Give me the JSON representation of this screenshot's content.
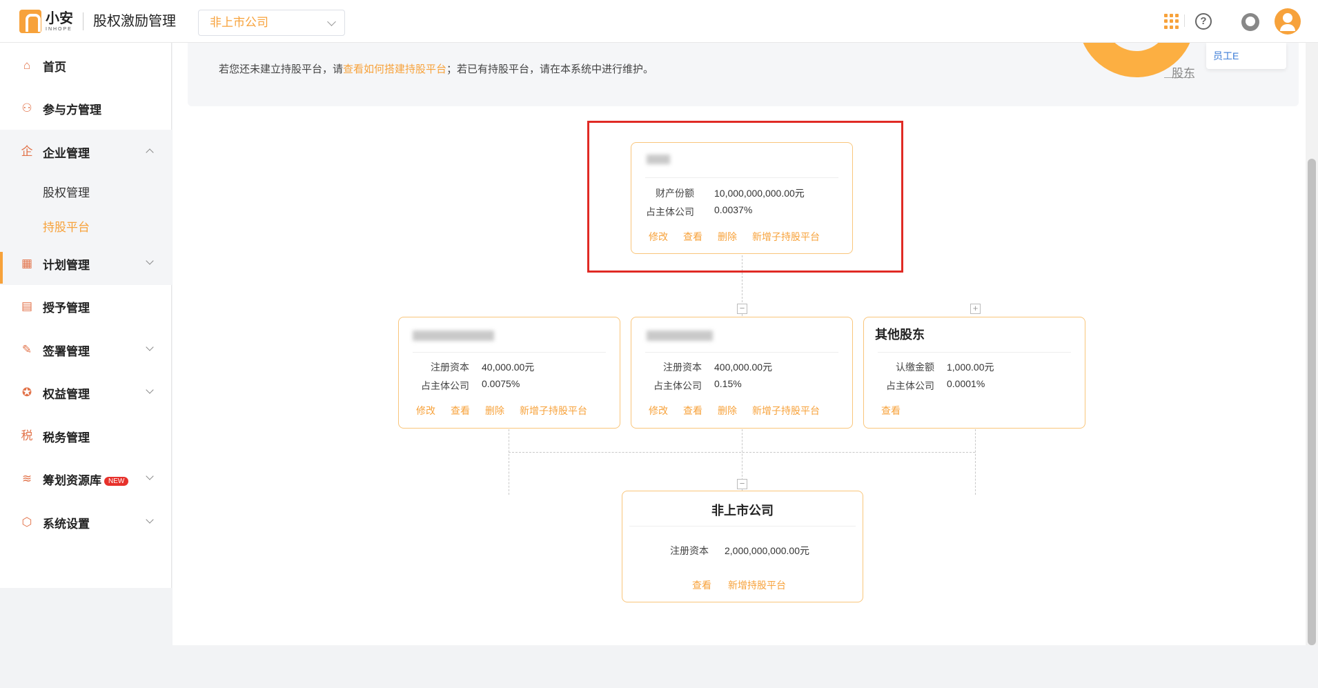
{
  "header": {
    "logo_cn": "小安",
    "logo_en": "INHOPE",
    "system_title": "股权激励管理",
    "company_select": "非上市公司"
  },
  "sidebar": {
    "items": [
      {
        "label": "首页",
        "icon": "home-icon"
      },
      {
        "label": "参与方管理",
        "icon": "users-icon"
      },
      {
        "label": "企业管理",
        "icon": "enterprise-icon"
      },
      {
        "label": "计划管理",
        "icon": "plan-icon"
      },
      {
        "label": "授予管理",
        "icon": "grant-icon"
      },
      {
        "label": "签署管理",
        "icon": "sign-icon"
      },
      {
        "label": "权益管理",
        "icon": "equity-icon"
      },
      {
        "label": "税务管理",
        "icon": "tax-icon"
      },
      {
        "label": "筹划资源库",
        "icon": "layers-icon",
        "badge": "NEW"
      },
      {
        "label": "系统设置",
        "icon": "settings-icon"
      }
    ],
    "sub_items": [
      {
        "label": "股权管理"
      },
      {
        "label": "持股平台",
        "active": true
      }
    ]
  },
  "notice": {
    "text_before": "若您还未建立持股平台，请",
    "link": "查看如何搭建持股平台",
    "text_after": "；若已有持股平台，请在本系统中进行维护。"
  },
  "chart_labels": {
    "donut_label": "股东",
    "legend_item": "员工E"
  },
  "cards": {
    "top": {
      "row1_label": "财产份额",
      "row1_value": "10,000,000,000.00元",
      "row2_label": "占主体公司",
      "row2_value": "0.0037%",
      "actions": [
        "修改",
        "查看",
        "删除",
        "新增子持股平台"
      ]
    },
    "mid_left": {
      "row1_label": "注册资本",
      "row1_value": "40,000.00元",
      "row2_label": "占主体公司",
      "row2_value": "0.0075%",
      "actions": [
        "修改",
        "查看",
        "删除",
        "新增子持股平台"
      ]
    },
    "mid_center": {
      "row1_label": "注册资本",
      "row1_value": "400,000.00元",
      "row2_label": "占主体公司",
      "row2_value": "0.15%",
      "actions": [
        "修改",
        "查看",
        "删除",
        "新增子持股平台"
      ]
    },
    "mid_right": {
      "name": "其他股东",
      "row1_label": "认缴金额",
      "row1_value": "1,000.00元",
      "row2_label": "占主体公司",
      "row2_value": "0.0001%",
      "actions": [
        "查看"
      ]
    },
    "bottom": {
      "name": "非上市公司",
      "row1_label": "注册资本",
      "row1_value": "2,000,000,000.00元",
      "actions": [
        "查看",
        "新增持股平台"
      ]
    }
  },
  "toggles": {
    "collapse": "−",
    "expand": "+"
  },
  "colors": {
    "accent": "#f7a23b",
    "highlight_box": "#e02a24",
    "card_border": "#f9c57a"
  }
}
